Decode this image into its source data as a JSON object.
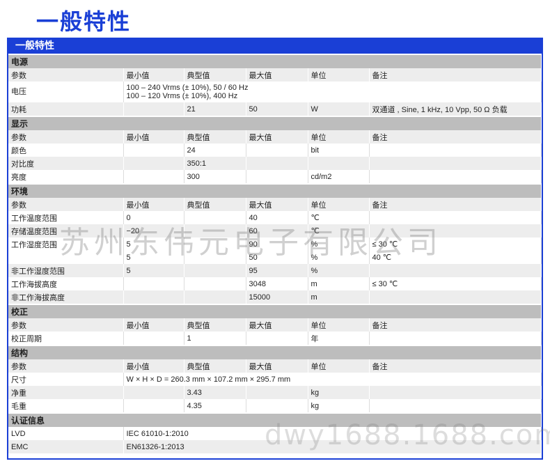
{
  "title": "一般特性",
  "box_header": "一般特性",
  "hdr": {
    "param": "参数",
    "min": "最小值",
    "typ": "典型值",
    "max": "最大值",
    "unit": "单位",
    "note": "备注"
  },
  "power": {
    "section": "电源",
    "voltage_label": "电压",
    "voltage_line1": "100 – 240 Vrms (± 10%), 50 / 60 Hz",
    "voltage_line2": "100 – 120 Vrms (± 10%), 400 Hz",
    "consumption": {
      "label": "功耗",
      "typ": "21",
      "max": "50",
      "unit": "W",
      "note": "双通道 , Sine, 1 kHz, 10 Vpp, 50 Ω 负载"
    }
  },
  "display": {
    "section": "显示",
    "rows": [
      {
        "label": "颜色",
        "typ": "24",
        "unit": "bit"
      },
      {
        "label": "对比度",
        "typ": "350:1",
        "unit": ""
      },
      {
        "label": "亮度",
        "typ": "300",
        "unit": "cd/m2"
      }
    ]
  },
  "env": {
    "section": "环境",
    "rows": [
      {
        "label": "工作温度范围",
        "min": "0",
        "max": "40",
        "unit": "℃",
        "note": ""
      },
      {
        "label": "存储温度范围",
        "min": "−20",
        "max": "60",
        "unit": "℃",
        "note": ""
      },
      {
        "label": "工作湿度范围",
        "min": "5",
        "max": "90",
        "unit": "%",
        "note": "≤ 30 ℃"
      },
      {
        "label": "",
        "min": "5",
        "max": "50",
        "unit": "%",
        "note": "40 ℃"
      },
      {
        "label": "非工作湿度范围",
        "min": "5",
        "max": "95",
        "unit": "%",
        "note": ""
      },
      {
        "label": "工作海拔高度",
        "min": "",
        "max": "3048",
        "unit": "m",
        "note": "≤ 30 ℃"
      },
      {
        "label": "非工作海拔高度",
        "min": "",
        "max": "15000",
        "unit": "m",
        "note": ""
      }
    ]
  },
  "calib": {
    "section": "校正",
    "label": "校正周期",
    "typ": "1",
    "unit": "年"
  },
  "struct": {
    "section": "结构",
    "size_label": "尺寸",
    "size": "W × H × D = 260.3 mm × 107.2 mm × 295.7 mm",
    "net_label": "净重",
    "net": "3.43",
    "net_unit": "kg",
    "gross_label": "毛重",
    "gross": "4.35",
    "gross_unit": "kg"
  },
  "cert": {
    "section": "认证信息",
    "lvd_label": "LVD",
    "lvd": "IEC 61010-1:2010",
    "emc_label": "EMC",
    "emc": "EN61326-1:2013"
  },
  "watermark_company": "苏州东伟元电子有限公司",
  "watermark_url": "dwy1688.1688.com"
}
